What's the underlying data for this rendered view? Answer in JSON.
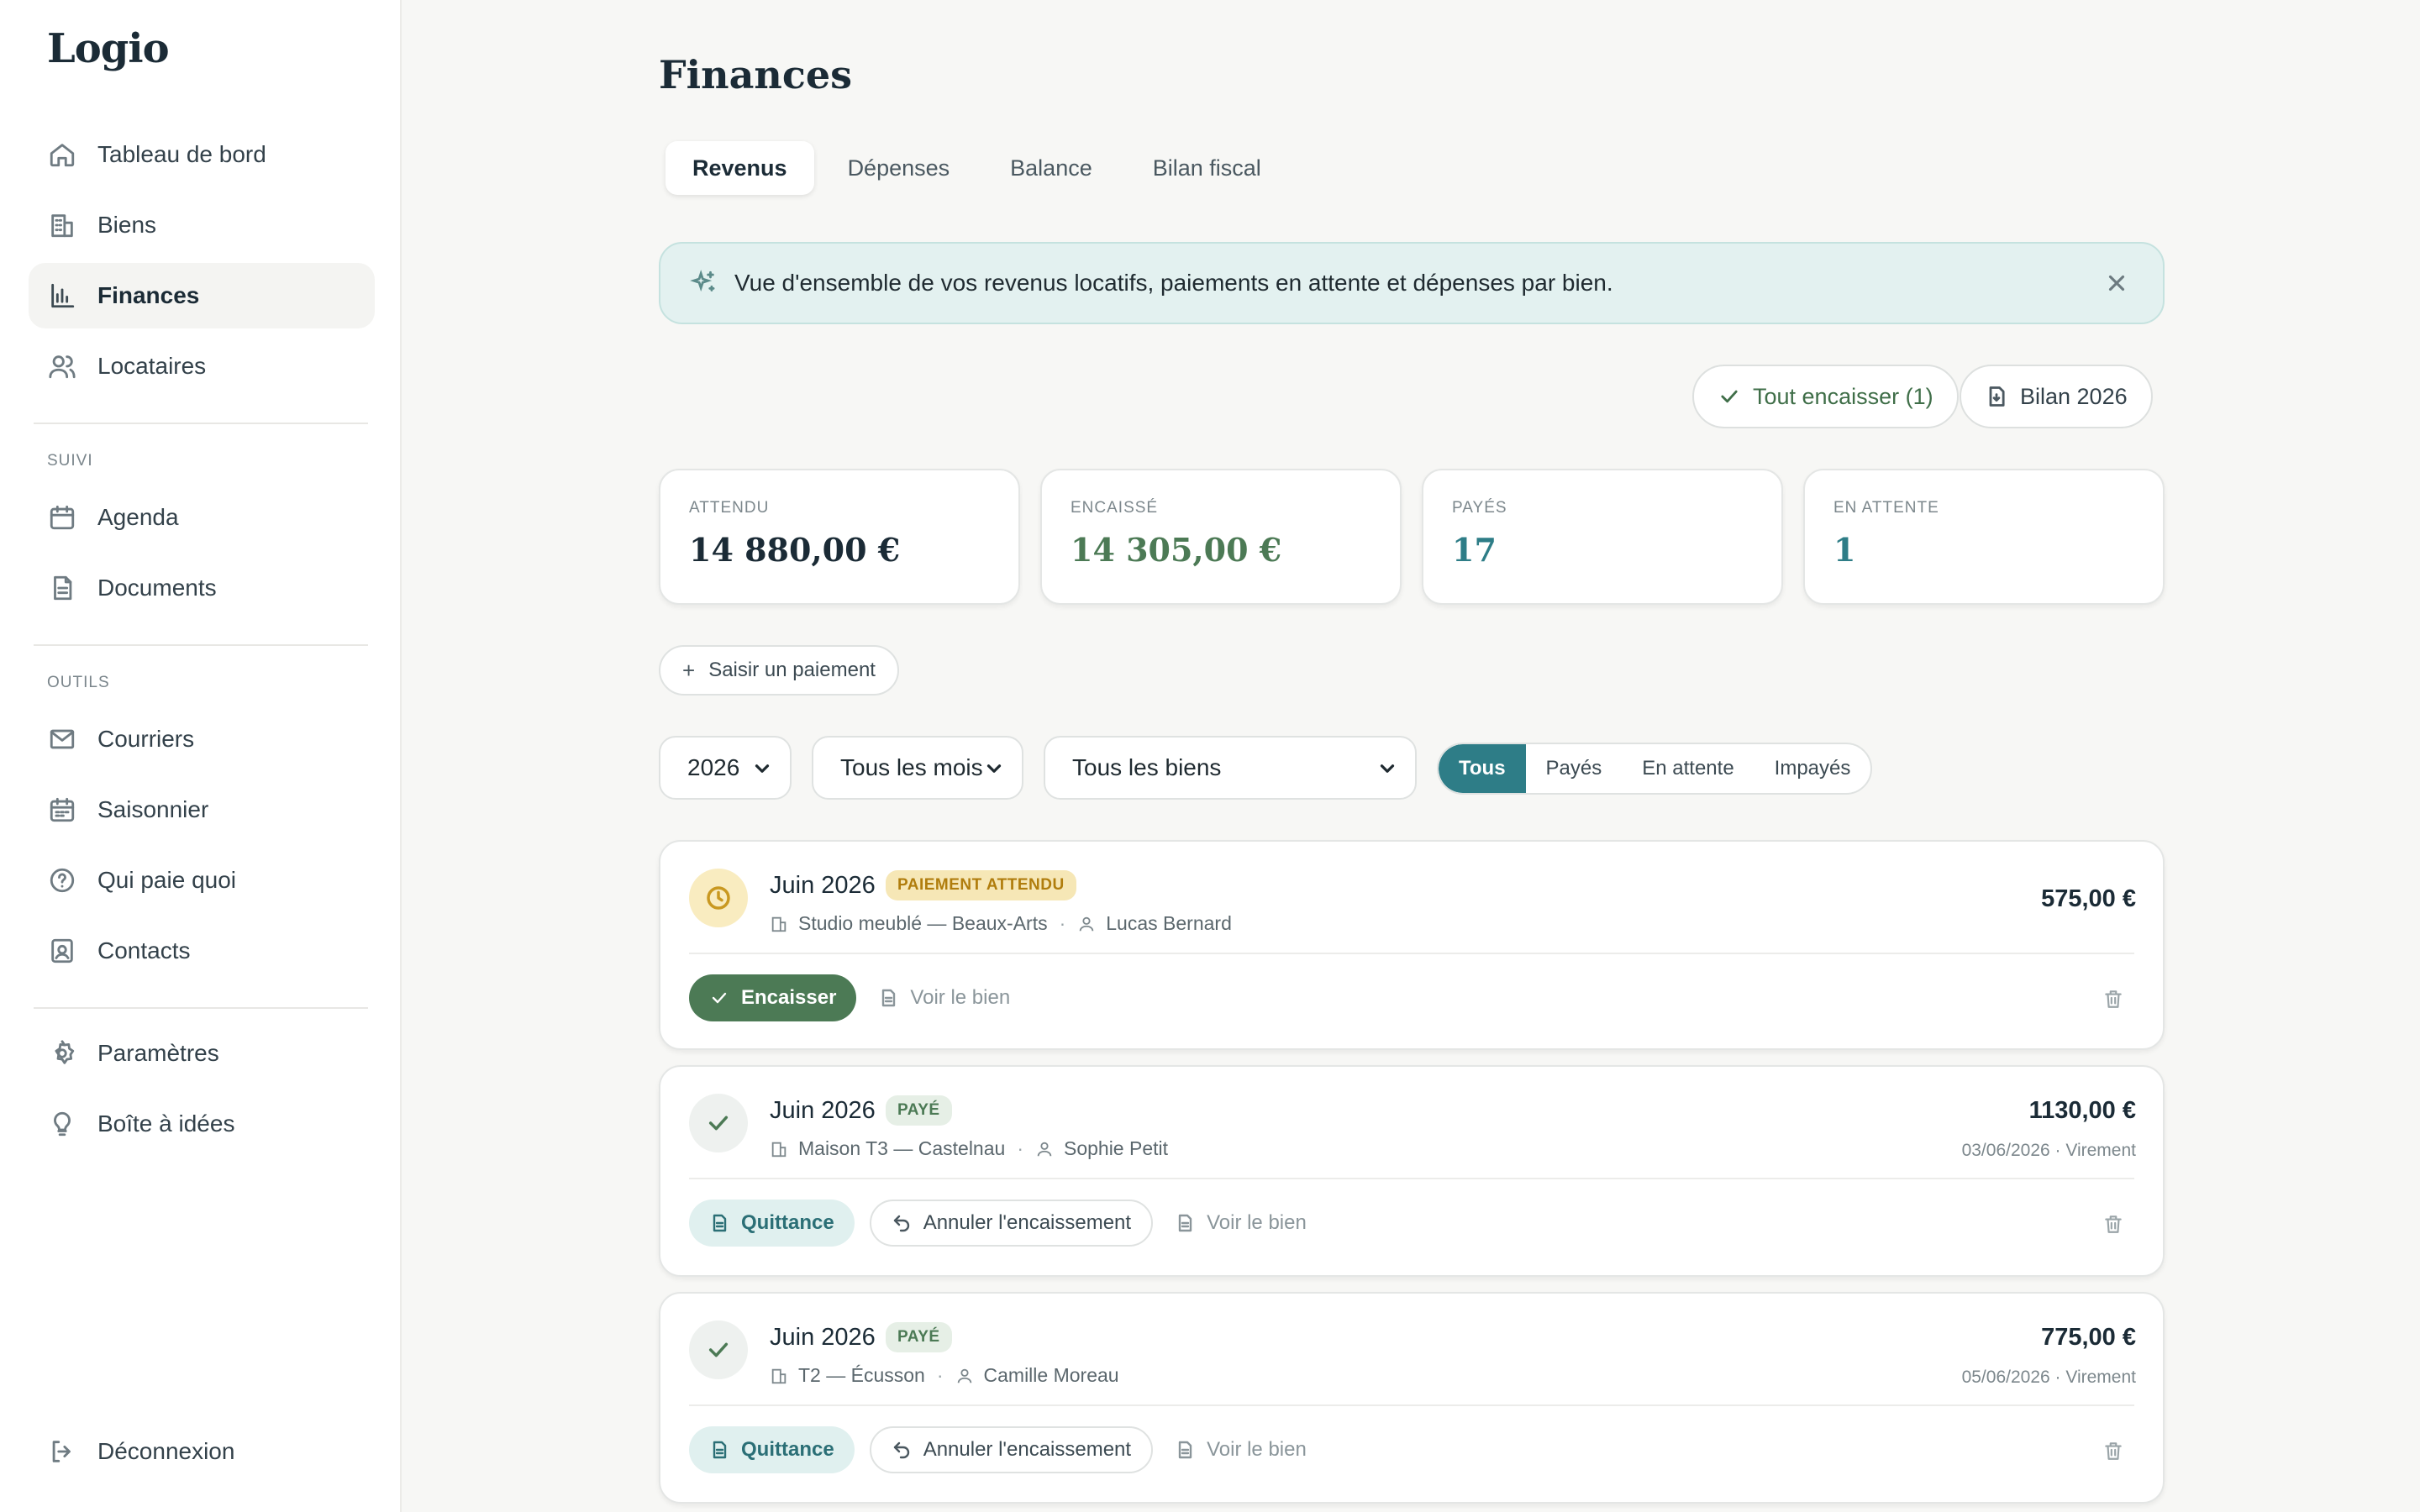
{
  "app": {
    "name": "Logio"
  },
  "sidebar": {
    "items": [
      {
        "label": "Tableau de bord",
        "icon": "home-icon"
      },
      {
        "label": "Biens",
        "icon": "building-icon"
      },
      {
        "label": "Finances",
        "icon": "bar-chart-icon",
        "active": true
      },
      {
        "label": "Locataires",
        "icon": "users-icon"
      }
    ],
    "section_suivi": "SUIVI",
    "suivi_items": [
      {
        "label": "Agenda",
        "icon": "calendar-icon"
      },
      {
        "label": "Documents",
        "icon": "document-icon"
      }
    ],
    "section_outils": "OUTILS",
    "outils_items": [
      {
        "label": "Courriers",
        "icon": "mail-icon"
      },
      {
        "label": "Saisonnier",
        "icon": "calendar-grid-icon"
      },
      {
        "label": "Qui paie quoi",
        "icon": "help-circle-icon"
      },
      {
        "label": "Contacts",
        "icon": "contact-card-icon"
      }
    ],
    "bottom_items": [
      {
        "label": "Paramètres",
        "icon": "gear-icon"
      },
      {
        "label": "Boîte à idées",
        "icon": "lightbulb-icon"
      }
    ],
    "logout": {
      "label": "Déconnexion",
      "icon": "logout-icon"
    }
  },
  "page": {
    "title": "Finances",
    "tabs": [
      {
        "label": "Revenus",
        "active": true
      },
      {
        "label": "Dépenses"
      },
      {
        "label": "Balance"
      },
      {
        "label": "Bilan fiscal"
      }
    ],
    "banner": "Vue d'ensemble de vos revenus locatifs, paiements en attente et dépenses par bien.",
    "collect_all_label": "Tout encaisser (1)",
    "report_label": "Bilan 2026",
    "stats": [
      {
        "label": "ATTENDU",
        "value": "14 880,00 €",
        "color": "#1b2b36"
      },
      {
        "label": "ENCAISSÉ",
        "value": "14 305,00 €",
        "color": "#4c7a55"
      },
      {
        "label": "PAYÉS",
        "value": "17",
        "color": "#2e7d87"
      },
      {
        "label": "EN ATTENTE",
        "value": "1",
        "color": "#2e7d87"
      }
    ],
    "add_payment_label": "Saisir un paiement",
    "filters": {
      "year": "2026",
      "month": "Tous les mois",
      "property": "Tous les biens",
      "status_options": [
        "Tous",
        "Payés",
        "En attente",
        "Impayés"
      ],
      "status_selected": "Tous"
    },
    "payments": [
      {
        "period": "Juin 2026",
        "status": "PAIEMENT ATTENDU",
        "property": "Studio meublé — Beaux-Arts",
        "tenant": "Lucas Bernard",
        "amount": "575,00 €",
        "collect_label": "Encaisser",
        "view_label": "Voir le bien"
      },
      {
        "period": "Juin 2026",
        "status": "PAYÉ",
        "property": "Maison T3 — Castelnau",
        "tenant": "Sophie Petit",
        "amount": "1130,00 €",
        "paid_info": "03/06/2026 · Virement",
        "receipt_label": "Quittance",
        "cancel_label": "Annuler l'encaissement",
        "view_label": "Voir le bien"
      },
      {
        "period": "Juin 2026",
        "status": "PAYÉ",
        "property": "T2 — Écusson",
        "tenant": "Camille Moreau",
        "amount": "775,00 €",
        "paid_info": "05/06/2026 · Virement",
        "receipt_label": "Quittance",
        "cancel_label": "Annuler l'encaissement",
        "view_label": "Voir le bien"
      }
    ]
  },
  "colors": {
    "accent_teal": "#2e7d87",
    "success_green": "#4c7a55",
    "pending_yellow": "#f6e7b6",
    "banner_bg": "#e3f1f0"
  }
}
